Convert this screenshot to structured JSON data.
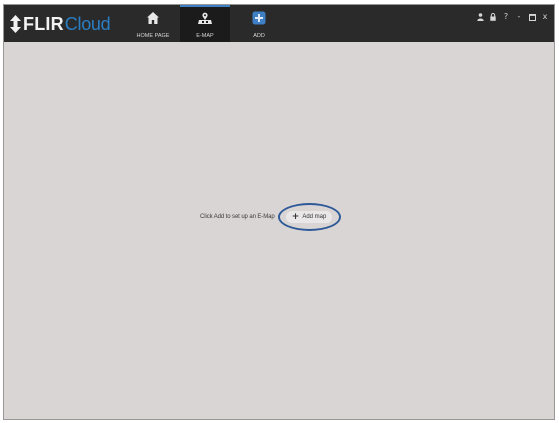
{
  "app": {
    "logo_primary": "FLIR",
    "logo_secondary": "Cloud"
  },
  "nav": {
    "tabs": [
      {
        "label": "HOME PAGE",
        "icon": "home-icon",
        "active": false
      },
      {
        "label": "E-MAP",
        "icon": "map-pin-icon",
        "active": true
      },
      {
        "label": "ADD",
        "icon": "add-icon",
        "active": false
      }
    ]
  },
  "window_controls": {
    "user": "user-icon",
    "lock": "lock-icon",
    "help": "?",
    "minimize": "-",
    "maximize": "maximize-icon",
    "close": "x"
  },
  "main": {
    "prompt": "Click Add to set up an E-Map",
    "add_map_label": "Add map",
    "add_map_plus": "+"
  },
  "colors": {
    "title_bar": "#2b2a2a",
    "background": "#d9d5d5",
    "accent_blue": "#2a7ec4",
    "highlight_ring": "#2f5a98"
  }
}
